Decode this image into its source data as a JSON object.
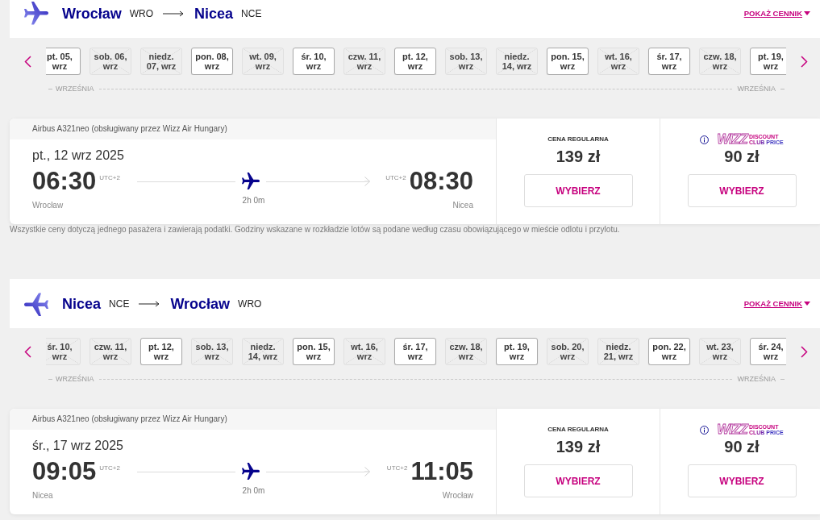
{
  "sections": [
    {
      "kind": "outbound",
      "route": {
        "origin": {
          "city": "Wrocław",
          "code": "WRO"
        },
        "destination": {
          "city": "Nicea",
          "code": "NCE"
        }
      },
      "price_list_link": "POKAŻ CENNIK",
      "dates": [
        {
          "label": "pt. 05, wrz",
          "available": true
        },
        {
          "label": "sob. 06, wrz",
          "available": false
        },
        {
          "label": "niedz. 07, wrz",
          "available": false
        },
        {
          "label": "pon. 08, wrz",
          "available": true
        },
        {
          "label": "wt. 09, wrz",
          "available": false
        },
        {
          "label": "śr. 10, wrz",
          "available": true
        },
        {
          "label": "czw. 11, wrz",
          "available": false
        },
        {
          "label": "pt. 12, wrz",
          "available": true
        },
        {
          "label": "sob. 13, wrz",
          "available": false
        },
        {
          "label": "niedz. 14, wrz",
          "available": false
        },
        {
          "label": "pon. 15, wrz",
          "available": true
        },
        {
          "label": "wt. 16, wrz",
          "available": false
        },
        {
          "label": "śr. 17, wrz",
          "available": true
        },
        {
          "label": "czw. 18, wrz",
          "available": false
        },
        {
          "label": "pt. 19, wrz",
          "available": true
        }
      ],
      "month_labels": [
        "WRZEŚNIA",
        "WRZEŚNIA"
      ],
      "flight": {
        "aircraft": "Airbus A321neo (obsługiwany przez Wizz Air Hungary)",
        "date": "pt., 12 wrz 2025",
        "departure": {
          "time": "06:30",
          "utc": "UTC+2",
          "city": "Wrocław"
        },
        "arrival": {
          "time": "08:30",
          "utc": "UTC+2",
          "city": "Nicea"
        },
        "duration": "2h 0m",
        "fares": [
          {
            "kind": "regular",
            "label": "CENA REGULARNA",
            "price": "139 zł",
            "button": "WYBIERZ"
          },
          {
            "kind": "club",
            "logo": {
              "brand": "WIZZ",
              "line_1": "DISCOUNT",
              "line_2": "CLUB PRICE"
            },
            "price": "90 zł",
            "button": "WYBIERZ"
          }
        ]
      },
      "note": "Wszystkie ceny dotyczą jednego pasażera i zawierają podatki. Godziny wskazane w rozkładzie lotów są podane według czasu obowiązującego w mieście odlotu i przylotu."
    },
    {
      "kind": "return",
      "route": {
        "origin": {
          "city": "Nicea",
          "code": "NCE"
        },
        "destination": {
          "city": "Wrocław",
          "code": "WRO"
        }
      },
      "price_list_link": "POKAŻ CENNIK",
      "dates": [
        {
          "label": "śr. 10, wrz",
          "available": false
        },
        {
          "label": "czw. 11, wrz",
          "available": false
        },
        {
          "label": "pt. 12, wrz",
          "available": true
        },
        {
          "label": "sob. 13, wrz",
          "available": false
        },
        {
          "label": "niedz. 14, wrz",
          "available": false
        },
        {
          "label": "pon. 15, wrz",
          "available": true
        },
        {
          "label": "wt. 16, wrz",
          "available": false
        },
        {
          "label": "śr. 17, wrz",
          "available": true
        },
        {
          "label": "czw. 18, wrz",
          "available": false
        },
        {
          "label": "pt. 19, wrz",
          "available": true
        },
        {
          "label": "sob. 20, wrz",
          "available": false
        },
        {
          "label": "niedz. 21, wrz",
          "available": false
        },
        {
          "label": "pon. 22, wrz",
          "available": true
        },
        {
          "label": "wt. 23, wrz",
          "available": false
        },
        {
          "label": "śr. 24, wrz",
          "available": true
        }
      ],
      "month_labels": [
        "WRZEŚNIA",
        "WRZEŚNIA"
      ],
      "flight": {
        "aircraft": "Airbus A321neo (obsługiwany przez Wizz Air Hungary)",
        "date": "śr., 17 wrz 2025",
        "departure": {
          "time": "09:05",
          "utc": "UTC+2",
          "city": "Nicea"
        },
        "arrival": {
          "time": "11:05",
          "utc": "UTC+2",
          "city": "Wrocław"
        },
        "duration": "2h 0m",
        "fares": [
          {
            "kind": "regular",
            "label": "CENA REGULARNA",
            "price": "139 zł",
            "button": "WYBIERZ"
          },
          {
            "kind": "club",
            "logo": {
              "brand": "WIZZ",
              "line_1": "DISCOUNT",
              "line_2": "CLUB PRICE"
            },
            "price": "90 zł",
            "button": "WYBIERZ"
          }
        ]
      }
    }
  ]
}
